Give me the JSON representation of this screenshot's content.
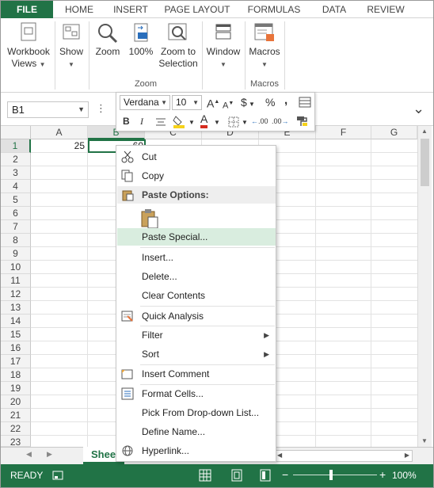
{
  "ribbon_tabs": [
    "FILE",
    "HOME",
    "INSERT",
    "PAGE LAYOUT",
    "FORMULAS",
    "DATA",
    "REVIEW"
  ],
  "ribbon": {
    "workbook_views": "Workbook Views",
    "show": "Show",
    "zoom": "Zoom",
    "zoom100": "100%",
    "zoom_to_selection": "Zoom to Selection",
    "zoom_group": "Zoom",
    "window": "Window",
    "macros": "Macros",
    "macros_group": "Macros"
  },
  "formula_bar": {
    "name_box": "B1"
  },
  "mini_toolbar": {
    "font": "Verdana",
    "size": "10",
    "grow_font": "A",
    "shrink_font": "A",
    "currency": "$",
    "percent": "%",
    "comma": ",",
    "bold": "B",
    "italic": "I",
    "font_color": "A",
    "inc_decimal": ".00",
    "dec_decimal": ".00",
    "accent_red": "#d62d20",
    "accent_yellow": "#f6d21a"
  },
  "grid": {
    "columns": [
      "A",
      "B",
      "C",
      "D",
      "E",
      "F",
      "G"
    ],
    "rows": [
      "1",
      "2",
      "3",
      "4",
      "5",
      "6",
      "7",
      "8",
      "9",
      "10",
      "11",
      "12",
      "13",
      "14",
      "15",
      "16",
      "17",
      "18",
      "19",
      "20",
      "21",
      "22",
      "23"
    ],
    "cells": {
      "A1": "25",
      "B1": "60"
    }
  },
  "context_menu": {
    "cut": "Cut",
    "copy": "Copy",
    "paste_options": "Paste Options:",
    "paste_special": "Paste Special...",
    "insert": "Insert...",
    "delete": "Delete...",
    "clear_contents": "Clear Contents",
    "quick_analysis": "Quick Analysis",
    "filter": "Filter",
    "sort": "Sort",
    "insert_comment": "Insert Comment",
    "format_cells": "Format Cells...",
    "pick_from_list": "Pick From Drop-down List...",
    "define_name": "Define Name...",
    "hyperlink": "Hyperlink..."
  },
  "sheet_tab": "Sheet1",
  "status": {
    "ready": "READY",
    "zoom_level": "100%"
  },
  "colors": {
    "excel_green": "#217346",
    "highlight": "#d9eddf"
  }
}
